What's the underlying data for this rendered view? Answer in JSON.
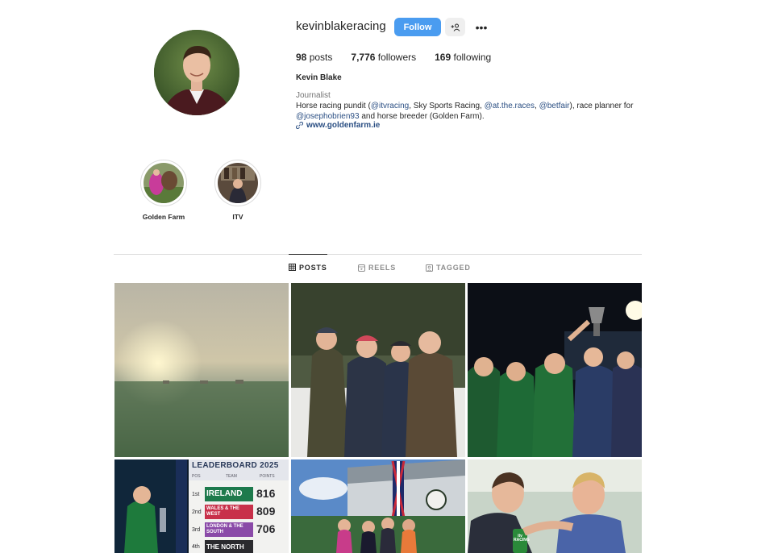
{
  "profile": {
    "username": "kevinblakeracing",
    "follow_label": "Follow",
    "more_label": "•••",
    "stats": {
      "posts_count": "98",
      "posts_label": "posts",
      "followers_count": "7,776",
      "followers_label": "followers",
      "following_count": "169",
      "following_label": "following"
    },
    "full_name": "Kevin Blake",
    "category": "Journalist",
    "bio": {
      "t1": "Horse racing pundit (",
      "m1": "@itvracing",
      "t2": ", Sky Sports Racing, ",
      "m2": "@at.the.races",
      "t3": ", ",
      "m3": "@betfair",
      "t4": "), race planner for",
      "m4": "@josephobrien93",
      "t5": " and horse breeder (Golden Farm)."
    },
    "website": "www.goldenfarm.ie"
  },
  "highlights": [
    {
      "label": "Golden Farm"
    },
    {
      "label": "ITV"
    }
  ],
  "tabs": [
    {
      "label": "POSTS",
      "icon": "grid-icon"
    },
    {
      "label": "REELS",
      "icon": "reels-icon"
    },
    {
      "label": "TAGGED",
      "icon": "tagged-icon"
    }
  ],
  "grid_overlays": {
    "leaderboard_title": "LEADERBOARD 2025",
    "col_pos": "POS",
    "col_team": "TEAM",
    "col_points": "POINTS",
    "rows": [
      {
        "pos": "1st",
        "team": "IRELAND",
        "points": "816"
      },
      {
        "pos": "2nd",
        "team": "WALES & THE WEST",
        "points": "809"
      },
      {
        "pos": "3rd",
        "team": "LONDON & THE SOUTH",
        "points": "706"
      },
      {
        "pos": "4th",
        "team": "THE NORTH",
        "points": ""
      }
    ],
    "itv_badge": "itv RACING"
  },
  "colors": {
    "accent": "#4a9cf0",
    "link": "#2b4f83",
    "divider": "#dbdbdb"
  }
}
